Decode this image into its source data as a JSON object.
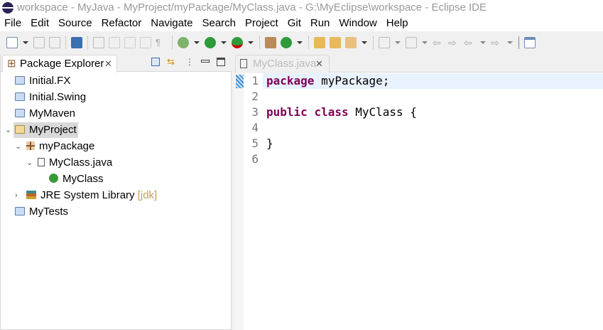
{
  "window": {
    "title": "workspace - MyJava - MyProject/myPackage/MyClass.java - G:\\MyEclipse\\workspace - Eclipse IDE"
  },
  "menu": [
    "File",
    "Edit",
    "Source",
    "Refactor",
    "Navigate",
    "Search",
    "Project",
    "Git",
    "Run",
    "Window",
    "Help"
  ],
  "explorer": {
    "title": "Package Explorer",
    "close": "✕",
    "items": [
      {
        "label": "Initial.FX",
        "icon": "project-folder-icon"
      },
      {
        "label": "Initial.Swing",
        "icon": "project-folder-icon"
      },
      {
        "label": "MyMaven",
        "icon": "project-folder-icon"
      },
      {
        "label": "MyProject",
        "icon": "open-project-icon"
      },
      {
        "label": "myPackage",
        "icon": "package-icon"
      },
      {
        "label": "MyClass.java",
        "icon": "java-file-icon"
      },
      {
        "label": "MyClass",
        "icon": "class-icon"
      },
      {
        "label": "JRE System Library",
        "suffix": "[jdk]",
        "icon": "library-icon"
      },
      {
        "label": "MyTests",
        "icon": "project-folder-icon"
      }
    ]
  },
  "editor": {
    "tab": "MyClass.java",
    "close": "✕",
    "line_numbers": [
      "1",
      "2",
      "3",
      "4",
      "5",
      "6"
    ],
    "code": {
      "l1_kw": "package",
      "l1_rest": " myPackage;",
      "l3_kw1": "public",
      "l3_kw2": "class",
      "l3_rest": " MyClass {",
      "l5": "}"
    }
  },
  "colors": {
    "keyword": "#7f0055",
    "selection": "#e8f2fe",
    "jdk": "#c0a060"
  }
}
